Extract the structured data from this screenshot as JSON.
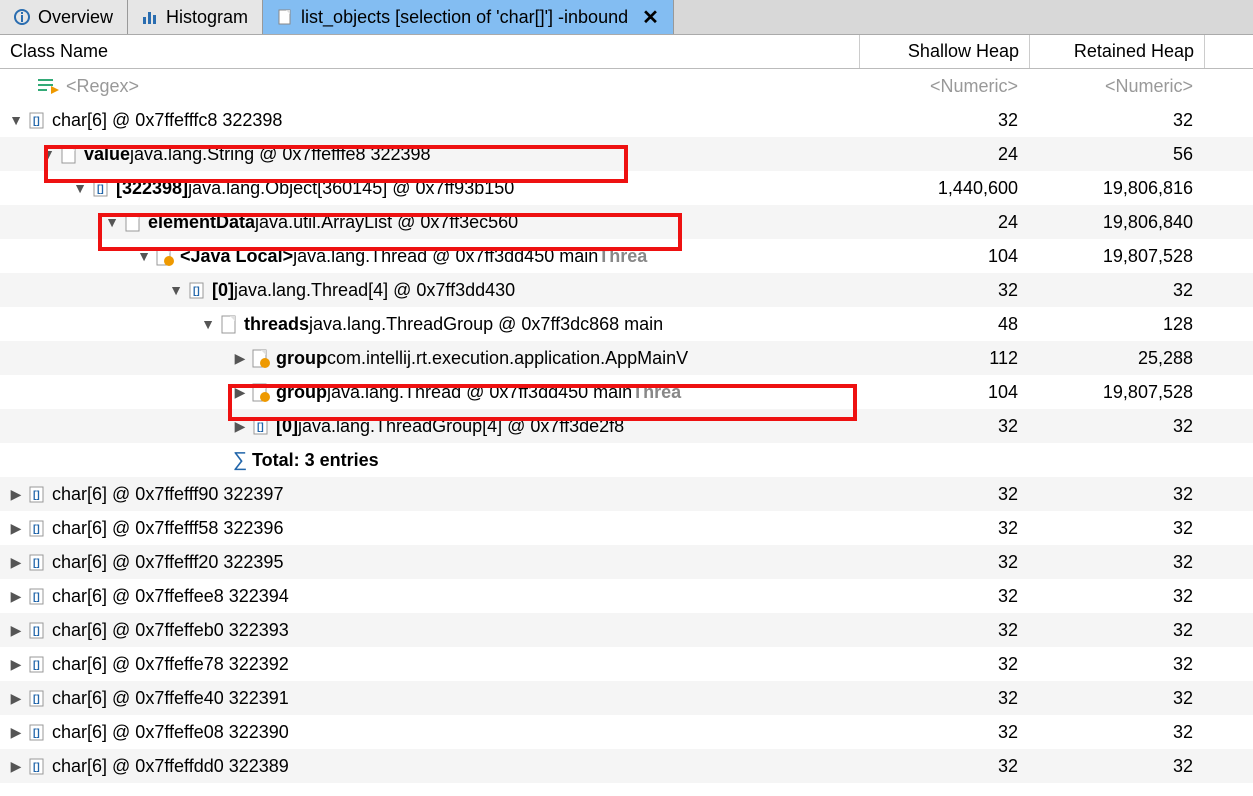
{
  "tabs": {
    "overview": "Overview",
    "histogram": "Histogram",
    "active": "list_objects  [selection of 'char[]'] -inbound"
  },
  "headers": {
    "name": "Class Name",
    "shallow": "Shallow Heap",
    "retained": "Retained Heap"
  },
  "filter": {
    "name_placeholder": "<Regex>",
    "num_placeholder": "<Numeric>"
  },
  "tree": [
    {
      "indent": 0,
      "toggle": "down",
      "icon": "array",
      "bold": "",
      "text": "char[6] @ 0x7ffefffc8  322398",
      "shallow": "32",
      "retained": "32",
      "stripe": false
    },
    {
      "indent": 1,
      "toggle": "down",
      "icon": "file",
      "bold": "value",
      "text": " java.lang.String @ 0x7ffefffe8  322398",
      "shallow": "24",
      "retained": "56",
      "stripe": true
    },
    {
      "indent": 2,
      "toggle": "down",
      "icon": "array",
      "bold": "[322398]",
      "text": " java.lang.Object[360145] @ 0x7ff93b150",
      "shallow": "1,440,600",
      "retained": "19,806,816",
      "stripe": false
    },
    {
      "indent": 3,
      "toggle": "down",
      "icon": "file",
      "bold": "elementData",
      "text": " java.util.ArrayList @ 0x7ff3ec560",
      "shallow": "24",
      "retained": "19,806,840",
      "stripe": true
    },
    {
      "indent": 4,
      "toggle": "down",
      "icon": "gc",
      "bold": "<Java Local>",
      "text": " java.lang.Thread @ 0x7ff3dd450  main",
      "suffixGrey": "  Threa",
      "shallow": "104",
      "retained": "19,807,528",
      "stripe": false
    },
    {
      "indent": 5,
      "toggle": "down",
      "icon": "array",
      "bold": "[0]",
      "text": " java.lang.Thread[4] @ 0x7ff3dd430",
      "shallow": "32",
      "retained": "32",
      "stripe": true
    },
    {
      "indent": 6,
      "toggle": "down",
      "icon": "file",
      "bold": "threads",
      "text": " java.lang.ThreadGroup @ 0x7ff3dc868  main",
      "shallow": "48",
      "retained": "128",
      "stripe": false
    },
    {
      "indent": 7,
      "toggle": "right",
      "icon": "gc",
      "bold": "group",
      "text": " com.intellij.rt.execution.application.AppMainV",
      "shallow": "112",
      "retained": "25,288",
      "stripe": true
    },
    {
      "indent": 7,
      "toggle": "right",
      "icon": "gc",
      "bold": "group",
      "text": " java.lang.Thread @ 0x7ff3dd450  main",
      "suffixGrey": "  Threa",
      "shallow": "104",
      "retained": "19,807,528",
      "stripe": false
    },
    {
      "indent": 7,
      "toggle": "right",
      "icon": "array",
      "bold": "[0]",
      "text": " java.lang.ThreadGroup[4] @ 0x7ff3de2f8",
      "shallow": "32",
      "retained": "32",
      "stripe": true
    },
    {
      "indent": 7,
      "toggle": "sum",
      "icon": "none",
      "bold": "Total: 3 entries",
      "text": "",
      "shallow": "",
      "retained": "",
      "stripe": false
    },
    {
      "indent": 0,
      "toggle": "right",
      "icon": "array",
      "bold": "",
      "text": "char[6] @ 0x7ffefff90  322397",
      "shallow": "32",
      "retained": "32",
      "stripe": true
    },
    {
      "indent": 0,
      "toggle": "right",
      "icon": "array",
      "bold": "",
      "text": "char[6] @ 0x7ffefff58  322396",
      "shallow": "32",
      "retained": "32",
      "stripe": false
    },
    {
      "indent": 0,
      "toggle": "right",
      "icon": "array",
      "bold": "",
      "text": "char[6] @ 0x7ffefff20  322395",
      "shallow": "32",
      "retained": "32",
      "stripe": true
    },
    {
      "indent": 0,
      "toggle": "right",
      "icon": "array",
      "bold": "",
      "text": "char[6] @ 0x7ffeffee8  322394",
      "shallow": "32",
      "retained": "32",
      "stripe": false
    },
    {
      "indent": 0,
      "toggle": "right",
      "icon": "array",
      "bold": "",
      "text": "char[6] @ 0x7ffeffeb0  322393",
      "shallow": "32",
      "retained": "32",
      "stripe": true
    },
    {
      "indent": 0,
      "toggle": "right",
      "icon": "array",
      "bold": "",
      "text": "char[6] @ 0x7ffeffe78  322392",
      "shallow": "32",
      "retained": "32",
      "stripe": false
    },
    {
      "indent": 0,
      "toggle": "right",
      "icon": "array",
      "bold": "",
      "text": "char[6] @ 0x7ffeffe40  322391",
      "shallow": "32",
      "retained": "32",
      "stripe": true
    },
    {
      "indent": 0,
      "toggle": "right",
      "icon": "array",
      "bold": "",
      "text": "char[6] @ 0x7ffeffe08  322390",
      "shallow": "32",
      "retained": "32",
      "stripe": false
    },
    {
      "indent": 0,
      "toggle": "right",
      "icon": "array",
      "bold": "",
      "text": "char[6] @ 0x7ffeffdd0  322389",
      "shallow": "32",
      "retained": "32",
      "stripe": true
    }
  ]
}
